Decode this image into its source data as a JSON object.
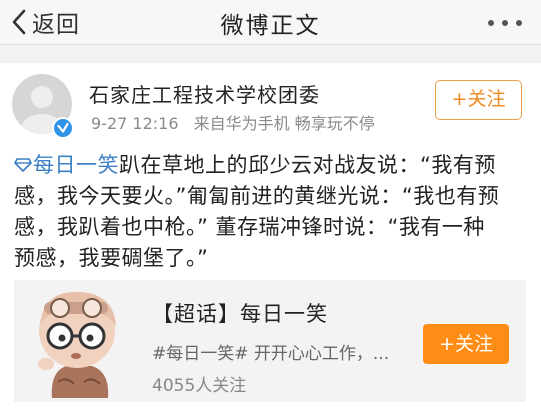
{
  "nav": {
    "back_label": "返回",
    "title": "微博正文"
  },
  "post": {
    "author": "石家庄工程技术学校团委",
    "time": "9-27 12:16",
    "source": "来自华为手机 畅享玩不停",
    "follow_label": "+关注",
    "topic": "每日一笑",
    "text_lines": [
      "趴在草地上的邱少云对战友说：“我有预",
      "感，我今天要火。”匍匐前进的黄继光说：“我也有预",
      "感，我趴着也中枪。” 董存瑞冲锋时说：“我有一种",
      "预感，我要碉堡了。”"
    ]
  },
  "card": {
    "title": "【超话】每日一笑",
    "desc": "#每日一笑# 开开心心工作，...",
    "count": "4055人关注",
    "follow_label": "+关注"
  },
  "colors": {
    "accent_orange": "#ff8c14",
    "link_blue": "#3b7fc4",
    "verified_blue": "#2f93e8"
  }
}
